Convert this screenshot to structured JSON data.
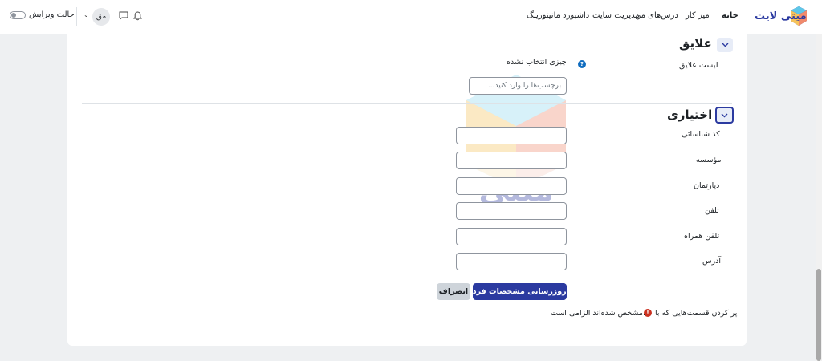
{
  "navbar": {
    "logo_text": "میتی لایت",
    "links": [
      {
        "label": "خانه",
        "active": true
      },
      {
        "label": "میز کار"
      },
      {
        "label": "درس‌های من"
      },
      {
        "label": "مدیریت سایت"
      },
      {
        "label": "داشبورد مانیتورینگ"
      }
    ],
    "edit_mode_label": "حالت ویرایش",
    "avatar_initials": "مق"
  },
  "interests": {
    "title": "علایق",
    "list_label": "لیست علایق",
    "nothing_selected": "چیزی انتخاب نشده",
    "tags_placeholder": "برچسب‌ها را وارد کنید..."
  },
  "optional": {
    "title": "اختیاری",
    "fields": [
      {
        "label": "کد شناسائی",
        "value": ""
      },
      {
        "label": "مؤسسه",
        "value": ""
      },
      {
        "label": "دپارتمان",
        "value": ""
      },
      {
        "label": "تلفن",
        "value": ""
      },
      {
        "label": "تلفن همراه",
        "value": ""
      },
      {
        "label": "آدرس",
        "value": ""
      }
    ]
  },
  "actions": {
    "submit_label": "به‌روزرسانی مشخصات فردی",
    "cancel_label": "انصراف"
  },
  "required_note": {
    "before": "پر کردن قسمت‌هایی که با",
    "after": "مشخص شده‌اند الزامی است."
  },
  "colors": {
    "primary": "#2b3aa0",
    "required": "#ca3120",
    "help": "#0f6cbf"
  }
}
